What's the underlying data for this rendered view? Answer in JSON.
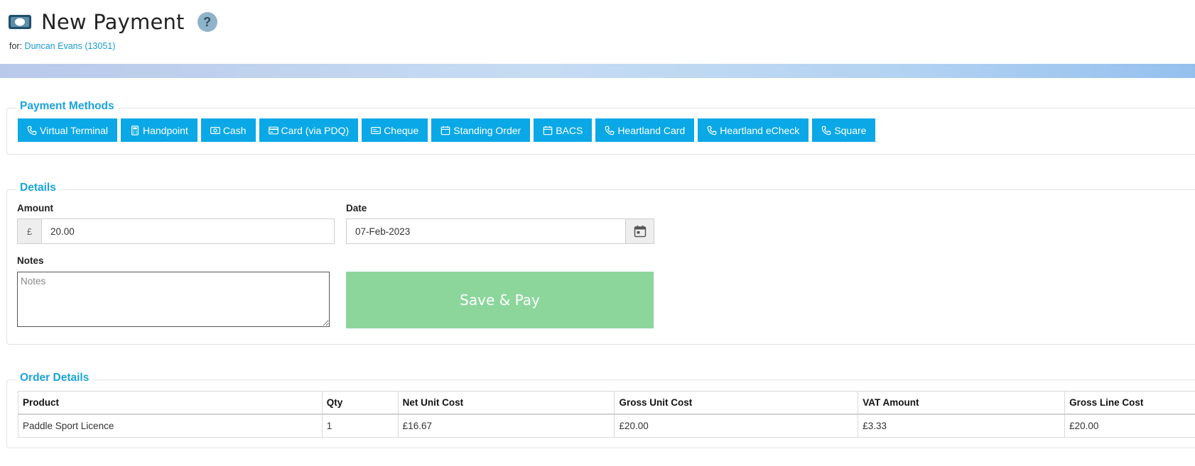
{
  "header": {
    "title": "New Payment",
    "help": "?",
    "for_prefix": "for:",
    "customer_link": "Duncan Evans (13051)"
  },
  "payment_methods": {
    "legend": "Payment Methods",
    "buttons": [
      {
        "label": "Virtual Terminal",
        "icon": "phone-icon"
      },
      {
        "label": "Handpoint",
        "icon": "calculator-icon"
      },
      {
        "label": "Cash",
        "icon": "cash-icon"
      },
      {
        "label": "Card (via PDQ)",
        "icon": "credit-card-icon"
      },
      {
        "label": "Cheque",
        "icon": "cheque-icon"
      },
      {
        "label": "Standing Order",
        "icon": "calendar-icon"
      },
      {
        "label": "BACS",
        "icon": "calendar-icon"
      },
      {
        "label": "Heartland Card",
        "icon": "phone-icon"
      },
      {
        "label": "Heartland eCheck",
        "icon": "phone-icon"
      },
      {
        "label": "Square",
        "icon": "phone-icon"
      }
    ],
    "button_color": "#0aa8e6"
  },
  "details": {
    "legend": "Details",
    "amount_label": "Amount",
    "currency_symbol": "£",
    "amount_value": "20.00",
    "date_label": "Date",
    "date_value": "07-Feb-2023",
    "notes_label": "Notes",
    "notes_placeholder": "Notes",
    "save_label": "Save & Pay",
    "save_color": "#8cd69c"
  },
  "order_details": {
    "legend": "Order Details",
    "columns": [
      "Product",
      "Qty",
      "Net Unit Cost",
      "Gross Unit Cost",
      "VAT Amount",
      "Gross Line Cost"
    ],
    "rows": [
      [
        "Paddle Sport Licence",
        "1",
        "£16.67",
        "£20.00",
        "£3.33",
        "£20.00"
      ]
    ]
  },
  "colors": {
    "accent": "#1aa3dd",
    "link": "#1a9ad6"
  }
}
